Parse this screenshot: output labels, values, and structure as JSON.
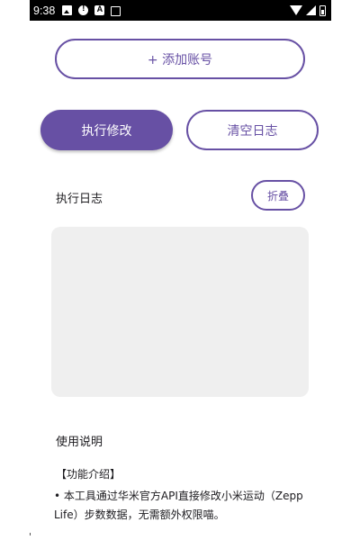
{
  "status_bar": {
    "time": "9:38",
    "icons": [
      "photo-icon",
      "alert-icon",
      "a-icon",
      "keyboard-icon",
      "wifi-icon",
      "signal-icon",
      "battery-icon"
    ]
  },
  "buttons": {
    "add_account": "+ 添加账号",
    "run": "执行修改",
    "clear_log": "清空日志",
    "fold": "折叠"
  },
  "log": {
    "title": "执行日志",
    "content": ""
  },
  "usage": {
    "title": "使用说明",
    "intro_title": "【功能介绍】",
    "intro_body": "• 本工具通过华米官方API直接修改小米运动（Zepp Life）步数数据，无需额外权限喵。"
  },
  "colors": {
    "accent": "#6750a4",
    "log_background": "#efefef",
    "status_bar": "#000000"
  }
}
